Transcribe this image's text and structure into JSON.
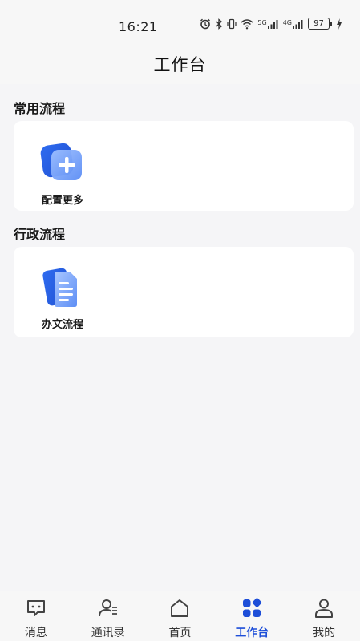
{
  "status_bar": {
    "time": "16:21",
    "battery": "97",
    "network_a": "5G",
    "network_b": "4G"
  },
  "header": {
    "title": "工作台"
  },
  "sections": [
    {
      "title": "常用流程",
      "items": [
        {
          "label": "配置更多",
          "icon": "add-config-icon"
        }
      ]
    },
    {
      "title": "行政流程",
      "items": [
        {
          "label": "办文流程",
          "icon": "document-icon"
        }
      ]
    }
  ],
  "tabbar": {
    "active": "工作台",
    "items": [
      {
        "label": "消息",
        "icon": "message-icon"
      },
      {
        "label": "通讯录",
        "icon": "contacts-icon"
      },
      {
        "label": "首页",
        "icon": "home-icon"
      },
      {
        "label": "工作台",
        "icon": "workbench-icon"
      },
      {
        "label": "我的",
        "icon": "profile-icon"
      }
    ]
  },
  "colors": {
    "accent": "#1d4ed8",
    "icon_blue": "#2563eb",
    "icon_light": "#93b4f5"
  }
}
